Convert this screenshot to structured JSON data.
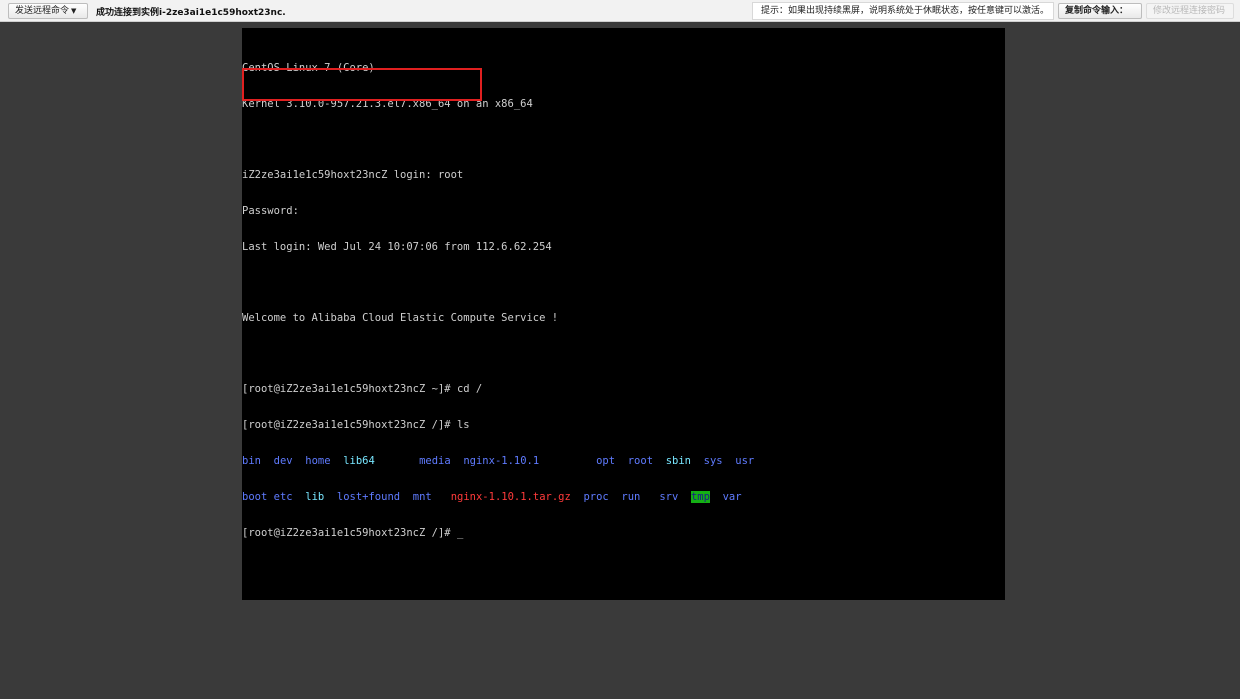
{
  "toolbar": {
    "send_command_label": "发送远程命令",
    "status": "成功连接到实例i-2ze3ai1e1c59hoxt23nc.",
    "hint": "提示：如果出现持续黑屏，说明系统处于休眠状态，按任意键可以激活。",
    "copy_input_label": "复制命令输入：",
    "modify_password_label": "修改远程连接密码"
  },
  "terminal": {
    "os_line": "CentOS Linux 7 (Core)",
    "kernel_line": "Kernel 3.10.0-957.21.3.el7.x86_64 on an x86_64",
    "login_line": "iZ2ze3ai1e1c59hoxt23ncZ login: root",
    "password_line": "Password:",
    "last_login_line": "Last login: Wed Jul 24 10:07:06 from 112.6.62.254",
    "welcome_line": "Welcome to Alibaba Cloud Elastic Compute Service !",
    "prompt_home": "[root@iZ2ze3ai1e1c59hoxt23ncZ ~]# ",
    "cmd_cd": "cd /",
    "prompt_root": "[root@iZ2ze3ai1e1c59hoxt23ncZ /]# ",
    "cmd_ls": "ls",
    "ls_row1": [
      "bin",
      "dev",
      "home",
      "lib64",
      "media",
      "nginx-1.10.1",
      "opt",
      "root",
      "sbin",
      "sys",
      "usr"
    ],
    "ls_row2": [
      "boot",
      "etc",
      "lib",
      "lost+found",
      "mnt",
      "nginx-1.10.1.tar.gz",
      "proc",
      "run",
      "srv",
      "tmp",
      "var"
    ],
    "cursor": "_"
  },
  "colors": {
    "background": "#3a3a3a",
    "screen": "#000000",
    "dir_blue": "#5f7bff",
    "link_cyan": "#78e6ff",
    "archive_red": "#ff3a3a",
    "highlight": "#e02020"
  }
}
